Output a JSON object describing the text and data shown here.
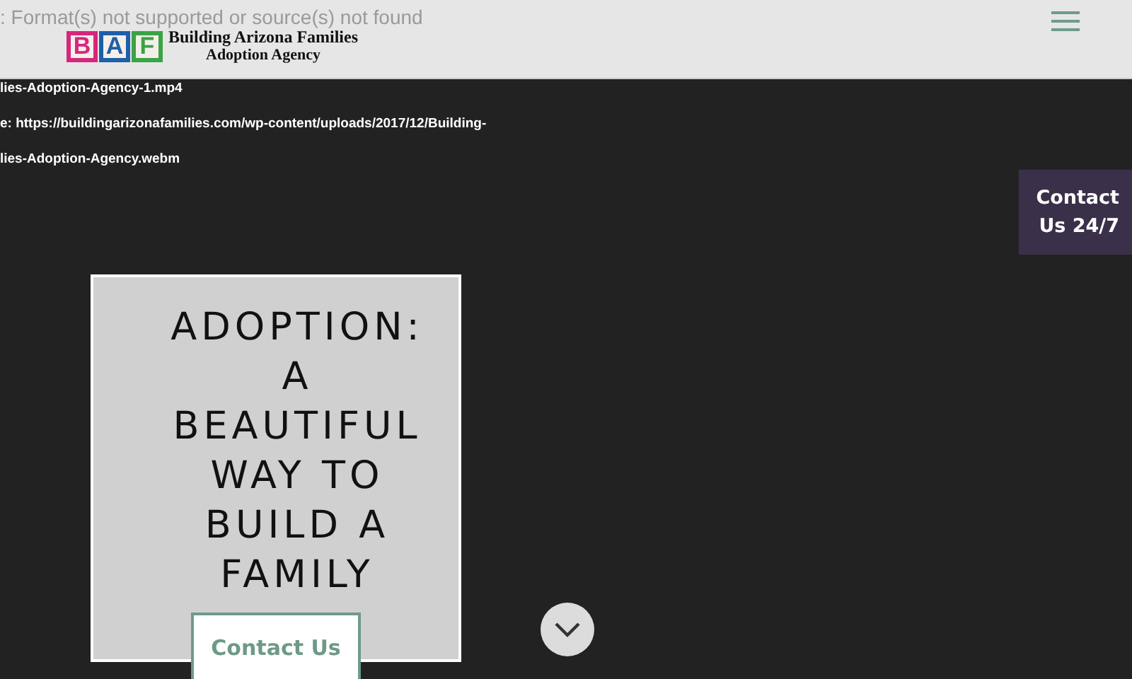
{
  "video_error": {
    "lines": [
      {
        "text": ": Format(s) not supported or source(s) not found",
        "kind": "title"
      },
      {
        "text": "lies-Adoption-Agency-1.mp4",
        "kind": "detail"
      },
      {
        "text": "e: https://buildingarizonafamilies.com/wp-content/uploads/2017/12/Building-",
        "kind": "detail"
      },
      {
        "text": "lies-Adoption-Agency.webm",
        "kind": "detail"
      }
    ]
  },
  "header": {
    "logo": {
      "blocks": [
        {
          "letter": "B",
          "color": "#d6267d"
        },
        {
          "letter": "A",
          "color": "#1e5fa8"
        },
        {
          "letter": "F",
          "color": "#3aa346"
        }
      ],
      "name": "Building Arizona Families",
      "subtitle": "Adoption Agency"
    }
  },
  "contact_tab": {
    "label": "Contact Us 24/7"
  },
  "hero": {
    "heading": [
      "ADOPTION:",
      "A",
      "BEAUTIFUL",
      "WAY TO",
      "BUILD A",
      "FAMILY"
    ],
    "button": "Contact Us"
  }
}
